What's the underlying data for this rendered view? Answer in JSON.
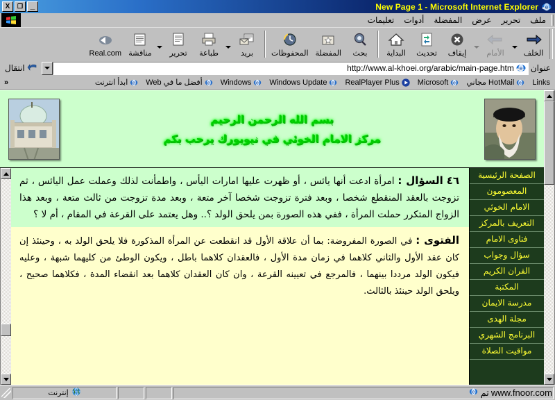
{
  "window": {
    "title": "New Page 1 - Microsoft Internet Explorer",
    "close_label": "X",
    "restore_label": "❐",
    "minimize_label": "_"
  },
  "menu": {
    "items": [
      {
        "label": "ملف",
        "name": "menu-file"
      },
      {
        "label": "تحرير",
        "name": "menu-edit"
      },
      {
        "label": "عرض",
        "name": "menu-view"
      },
      {
        "label": "المفضلة",
        "name": "menu-favorites"
      },
      {
        "label": "أدوات",
        "name": "menu-tools"
      },
      {
        "label": "تعليمات",
        "name": "menu-help"
      }
    ]
  },
  "toolbar": {
    "buttons": [
      {
        "label": "الخلف",
        "icon": "back-arrow-icon",
        "disabled": false
      },
      {
        "label": "الأمام",
        "icon": "forward-arrow-icon",
        "disabled": true
      },
      {
        "label": "إيقاف",
        "icon": "stop-icon",
        "disabled": false
      },
      {
        "label": "تحديث",
        "icon": "refresh-icon",
        "disabled": false
      },
      {
        "label": "البداية",
        "icon": "home-icon",
        "disabled": false
      },
      {
        "label": "بحث",
        "icon": "search-icon",
        "disabled": false
      },
      {
        "label": "المفضلة",
        "icon": "favorites-star-icon",
        "disabled": false
      },
      {
        "label": "المحفوظات",
        "icon": "history-clock-icon",
        "disabled": false
      },
      {
        "label": "بريد",
        "icon": "mail-icon",
        "disabled": false
      },
      {
        "label": "طباعة",
        "icon": "printer-icon",
        "disabled": false
      },
      {
        "label": "تحرير",
        "icon": "edit-page-icon",
        "disabled": false
      },
      {
        "label": "مناقشة",
        "icon": "discuss-icon",
        "disabled": false
      },
      {
        "label": "Real.com",
        "icon": "realcom-icon",
        "disabled": false
      }
    ]
  },
  "address": {
    "label": "عنوان",
    "url": "http://www.al-khoei.org/arabic/main-page.htm",
    "go_label": "انتقال"
  },
  "links": {
    "label": "Links",
    "items": [
      {
        "label": "Links",
        "icon": "ie-page-icon"
      },
      {
        "label": "HotMail مجاني",
        "icon": "ie-page-icon"
      },
      {
        "label": "Microsoft",
        "icon": "ie-page-icon"
      },
      {
        "label": "RealPlayer Plus",
        "icon": "realplayer-icon"
      },
      {
        "label": "Windows Update",
        "icon": "ie-page-icon"
      },
      {
        "label": "Windows",
        "icon": "ie-page-icon"
      },
      {
        "label": "أفضل ما في Web",
        "icon": "ie-page-icon"
      },
      {
        "label": "ابدأ انترنت",
        "icon": "ie-page-icon"
      }
    ],
    "overflow_label": "«"
  },
  "banner": {
    "line1": "بسم الله الرحمن الرحيم",
    "line2": "مركز الامام الخوئي في نيويورك يرحب بكم",
    "left_photo_alt": "mosque-building-photo",
    "right_photo_alt": "cleric-portrait-photo",
    "text_color": "#00cc00",
    "bg_color": "#ccffcc"
  },
  "sidebar": {
    "bg_color": "#1d3b1d",
    "text_color": "#ffff33",
    "items": [
      {
        "label": "الصفحة الرئيسية"
      },
      {
        "label": "المعصومون"
      },
      {
        "label": "الامام الخوئي"
      },
      {
        "label": "التعريف بالمركز"
      },
      {
        "label": "فتاوى الامام"
      },
      {
        "label": "سؤال وجواب"
      },
      {
        "label": "القران الكريم"
      },
      {
        "label": "المكتبة"
      },
      {
        "label": "مدرسة الايمان"
      },
      {
        "label": "مجلة الهدى"
      },
      {
        "label": "البرنامج الشهري"
      },
      {
        "label": "مواقيت الصلاة"
      }
    ]
  },
  "content": {
    "question_number": "٤٦",
    "question_label": "السؤال :",
    "question_text": "امرأة ادعت أنها يائس ، أو ظهرت عليها امارات اليأس ، واطمأنت لذلك وعملت عمل اليائس ، ثم تزوجت بالعقد المنقطع شخصا ، وبعد فترة تزوجت شخصا آخر متعة ، وبعد مدة تزوجت من ثالث متعة ، وبعد هذا الزواج المتكرر حملت المرأة ، ففي هذه الصورة بمن يلحق الولد ؟.. وهل يعتمد على القرعة في المقام ، أم لا ؟",
    "answer_label": "الفتوى :",
    "answer_text": "في الصورة المفروضة: بما أن علاقة الأول قد انقطعت عن المرأة المذكورة فلا يلحق الولد به ، وحينئذ إن كان عقد الأول والثاني كلاهما في زمان مدة الأول ، فالعقدان كلاهما باطل ، ويكون الوطئ من كليهما شبهة ، وعليه فيكون الولد مرددا بينهما ، فالمرجع في تعيينه القرعة ، وان كان العقدان كلاهما بعد انقضاء المدة ، فكلاهما صحيح ، ويلحق الولد حينئذ بالثالث.",
    "question_bg": "#ccffcc",
    "answer_bg": "#ffffcc"
  },
  "status": {
    "message": "",
    "zone": "إنترنت",
    "zone_icon": "globe-icon",
    "watermark": "www.fnoor.com",
    "watermark_prefix": "تم"
  }
}
